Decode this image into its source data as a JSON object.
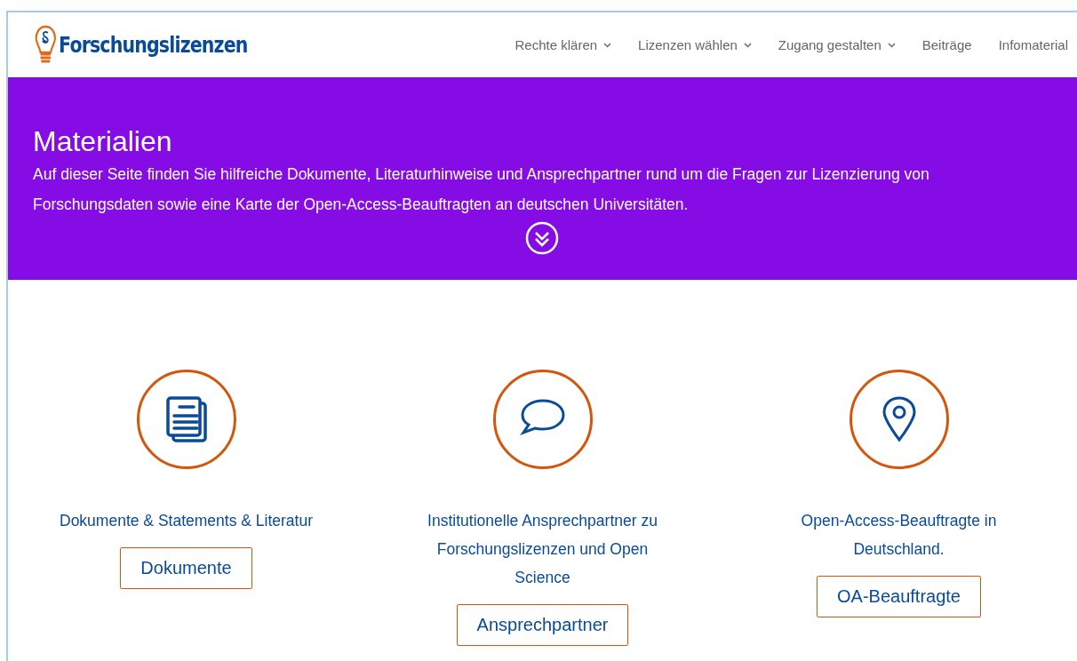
{
  "header": {
    "logo": "Forschungslizenzen",
    "nav": [
      {
        "label": "Rechte klären",
        "kind": "dropdown"
      },
      {
        "label": "Lizenzen wählen",
        "kind": "dropdown"
      },
      {
        "label": "Zugang gestalten",
        "kind": "dropdown"
      },
      {
        "label": "Beiträge",
        "kind": "link"
      },
      {
        "label": "Infomaterial",
        "kind": "link"
      }
    ]
  },
  "banner": {
    "title": "Materialien",
    "text": "Auf dieser Seite finden Sie hilfreiche Dokumente, Literaturhinweise und Ansprechpartner rund um die Fragen zur Lizenzierung von Forschungsdaten sowie eine Karte der Open-Access-Beauftragten an deutschen Universitäten."
  },
  "cards": [
    {
      "kind": "documents",
      "caption": "Dokumente & Statements & Literatur",
      "button": "Dokumente"
    },
    {
      "kind": "speech",
      "caption": "Institutionelle Ansprechpartner zu Forschungslizenzen und Open Science",
      "button": "Ansprechpartner"
    },
    {
      "kind": "pin",
      "caption": "Open-Access-Beauftragte in Deutschland.",
      "button": "OA-Beauftragte"
    }
  ]
}
